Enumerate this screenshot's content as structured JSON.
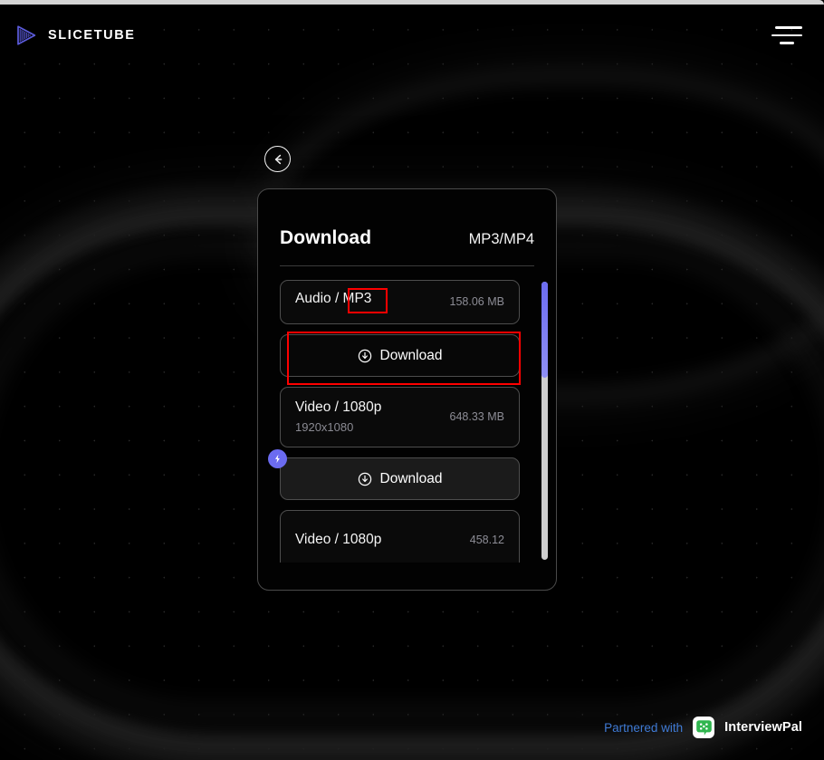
{
  "header": {
    "brand_name": "SLICETUBE",
    "logo_icon": "play-triangle-striped-icon",
    "menu_icon": "hamburger-menu-icon"
  },
  "back_button": {
    "icon": "arrow-left-circle-icon",
    "label": ""
  },
  "card": {
    "title": "Download",
    "format_label": "MP3/MP4",
    "rows": [
      {
        "kind": "format",
        "name": "Audio / MP3",
        "sub": "",
        "size": "158.06 MB",
        "highlighted_text": "MP3"
      },
      {
        "kind": "download",
        "label": "Download",
        "icon": "download-circle-icon",
        "badge": null,
        "highlighted": true
      },
      {
        "kind": "format",
        "name": "Video / 1080p",
        "sub": "1920x1080",
        "size": "648.33 MB"
      },
      {
        "kind": "download",
        "label": "Download",
        "icon": "download-circle-icon",
        "badge": "lightning-bolt-icon",
        "highlighted": false
      },
      {
        "kind": "format",
        "name": "Video / 1080p",
        "sub": "",
        "size": "458.12"
      }
    ],
    "scrollbar": {
      "thumb_position_percent": 0,
      "thumb_size_percent": 34,
      "thumb_color": "#6c6cf2",
      "track_color": "#cfcfcf"
    }
  },
  "footer": {
    "partnered_label": "Partnered with",
    "partner_name": "InterviewPal",
    "partner_icon": "green-chat-bubble-dots-icon"
  },
  "colors": {
    "background": "#000000",
    "accent_purple": "#6b6bf0",
    "annotation_red": "#ff0000",
    "partner_link_blue": "#3f7ad4",
    "partner_green": "#2fb54e"
  }
}
